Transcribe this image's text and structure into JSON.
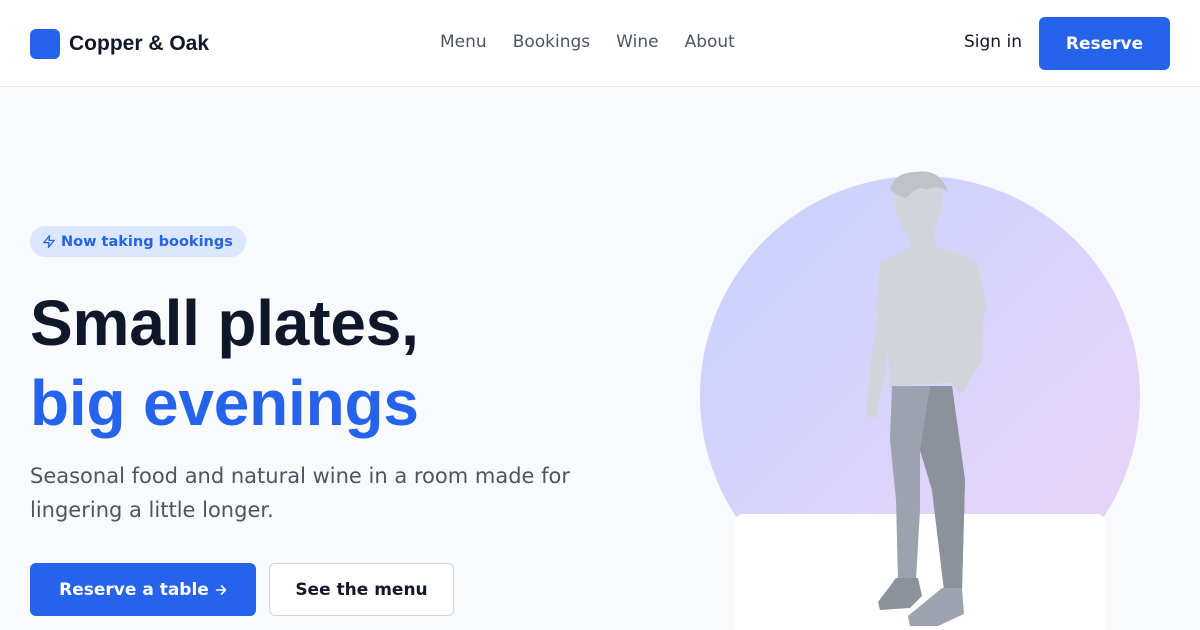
{
  "header": {
    "brand_name": "Copper & Oak",
    "nav": [
      {
        "label": "Menu"
      },
      {
        "label": "Bookings"
      },
      {
        "label": "Wine"
      },
      {
        "label": "About"
      }
    ],
    "sign_in_label": "Sign in",
    "reserve_label": "Reserve"
  },
  "hero": {
    "badge": {
      "icon": "lightning-icon",
      "text": "Now taking bookings"
    },
    "headline_line1": "Small plates,",
    "headline_line2": "big evenings",
    "lede": "Seasonal food and natural wine in a room made for lingering a little longer.",
    "primary_cta": "Reserve a table",
    "primary_cta_icon": "arrow-right-icon",
    "secondary_cta": "See the menu",
    "illustration": "person-standing-illustration"
  },
  "colors": {
    "accent": "#2563eb",
    "heading": "#0f172a",
    "body_text": "#4b5563",
    "badge_bg": "#dbe7fd",
    "page_bg": "#f8fafc"
  }
}
